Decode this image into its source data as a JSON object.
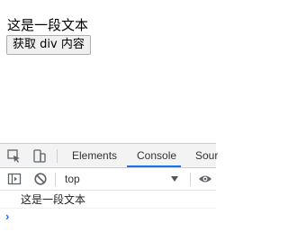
{
  "page": {
    "text": "这是一段文本",
    "button_label": "获取 div 内容"
  },
  "devtools": {
    "tabs": [
      {
        "label": "Elements",
        "active": false
      },
      {
        "label": "Console",
        "active": true
      },
      {
        "label": "Sour",
        "active": false
      }
    ],
    "context": "top",
    "console_output": [
      "这是一段文本"
    ],
    "prompt_symbol": "›",
    "accent_color": "#1a73e8"
  }
}
